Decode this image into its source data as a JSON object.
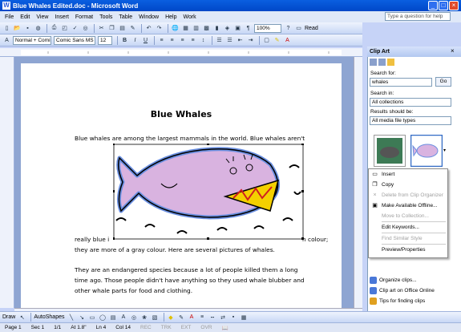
{
  "window": {
    "title": "Blue Whales Edited.doc - Microsoft Word",
    "icon": "W"
  },
  "menu": [
    "File",
    "Edit",
    "View",
    "Insert",
    "Format",
    "Tools",
    "Table",
    "Window",
    "Help",
    "Work"
  ],
  "help_placeholder": "Type a question for help",
  "format": {
    "style": "Normal + Comi",
    "font": "Comic Sans MS",
    "size": "12"
  },
  "standard": {
    "zoom": "100%",
    "read_label": "Read"
  },
  "document": {
    "title": "Blue Whales",
    "para1_line1": "Blue whales are among the largest mammals in the world. Blue whales aren't",
    "para1_line2a": "really blue i",
    "para1_line2b": "n colour;",
    "para1_line3": "they are more of a gray colour. Here are several pictures of whales.",
    "para2_line1": "They are an endangered species because a lot of people killed them a long",
    "para2_line2": "time ago. Those people didn't have anything so they used whale blubber and",
    "para2_line3": "other whale parts for food and clothing."
  },
  "clipart": {
    "title": "Clip Art",
    "search_for_label": "Search for:",
    "search_value": "whales",
    "go_label": "Go",
    "search_in_label": "Search in:",
    "search_in_value": "All collections",
    "results_label": "Results should be:",
    "results_value": "All media file types",
    "links": [
      "Organize clips...",
      "Clip art on Office Online",
      "Tips for finding clips"
    ]
  },
  "context_menu": [
    {
      "label": "Insert",
      "enabled": true
    },
    {
      "label": "Copy",
      "enabled": true
    },
    {
      "label": "Delete from Clip Organizer",
      "enabled": false
    },
    {
      "label": "Make Available Offline...",
      "enabled": true
    },
    {
      "label": "Move to Collection...",
      "enabled": false
    },
    {
      "label": "Edit Keywords...",
      "enabled": true
    },
    {
      "label": "Find Similar Style",
      "enabled": false
    },
    {
      "label": "Preview/Properties",
      "enabled": true
    }
  ],
  "drawing": {
    "draw_label": "Draw",
    "autoshapes_label": "AutoShapes"
  },
  "status": {
    "page": "Page 1",
    "sec": "Sec 1",
    "pages": "1/1",
    "at": "At 1.8\"",
    "ln": "Ln 4",
    "col": "Col 14",
    "rec": "REC",
    "trk": "TRK",
    "ext": "EXT",
    "ovr": "OVR"
  },
  "colors": {
    "title_bar": "#0a5fe0",
    "whale_body": "#d9b3e0",
    "whale_outline": "#6a8fe0"
  }
}
